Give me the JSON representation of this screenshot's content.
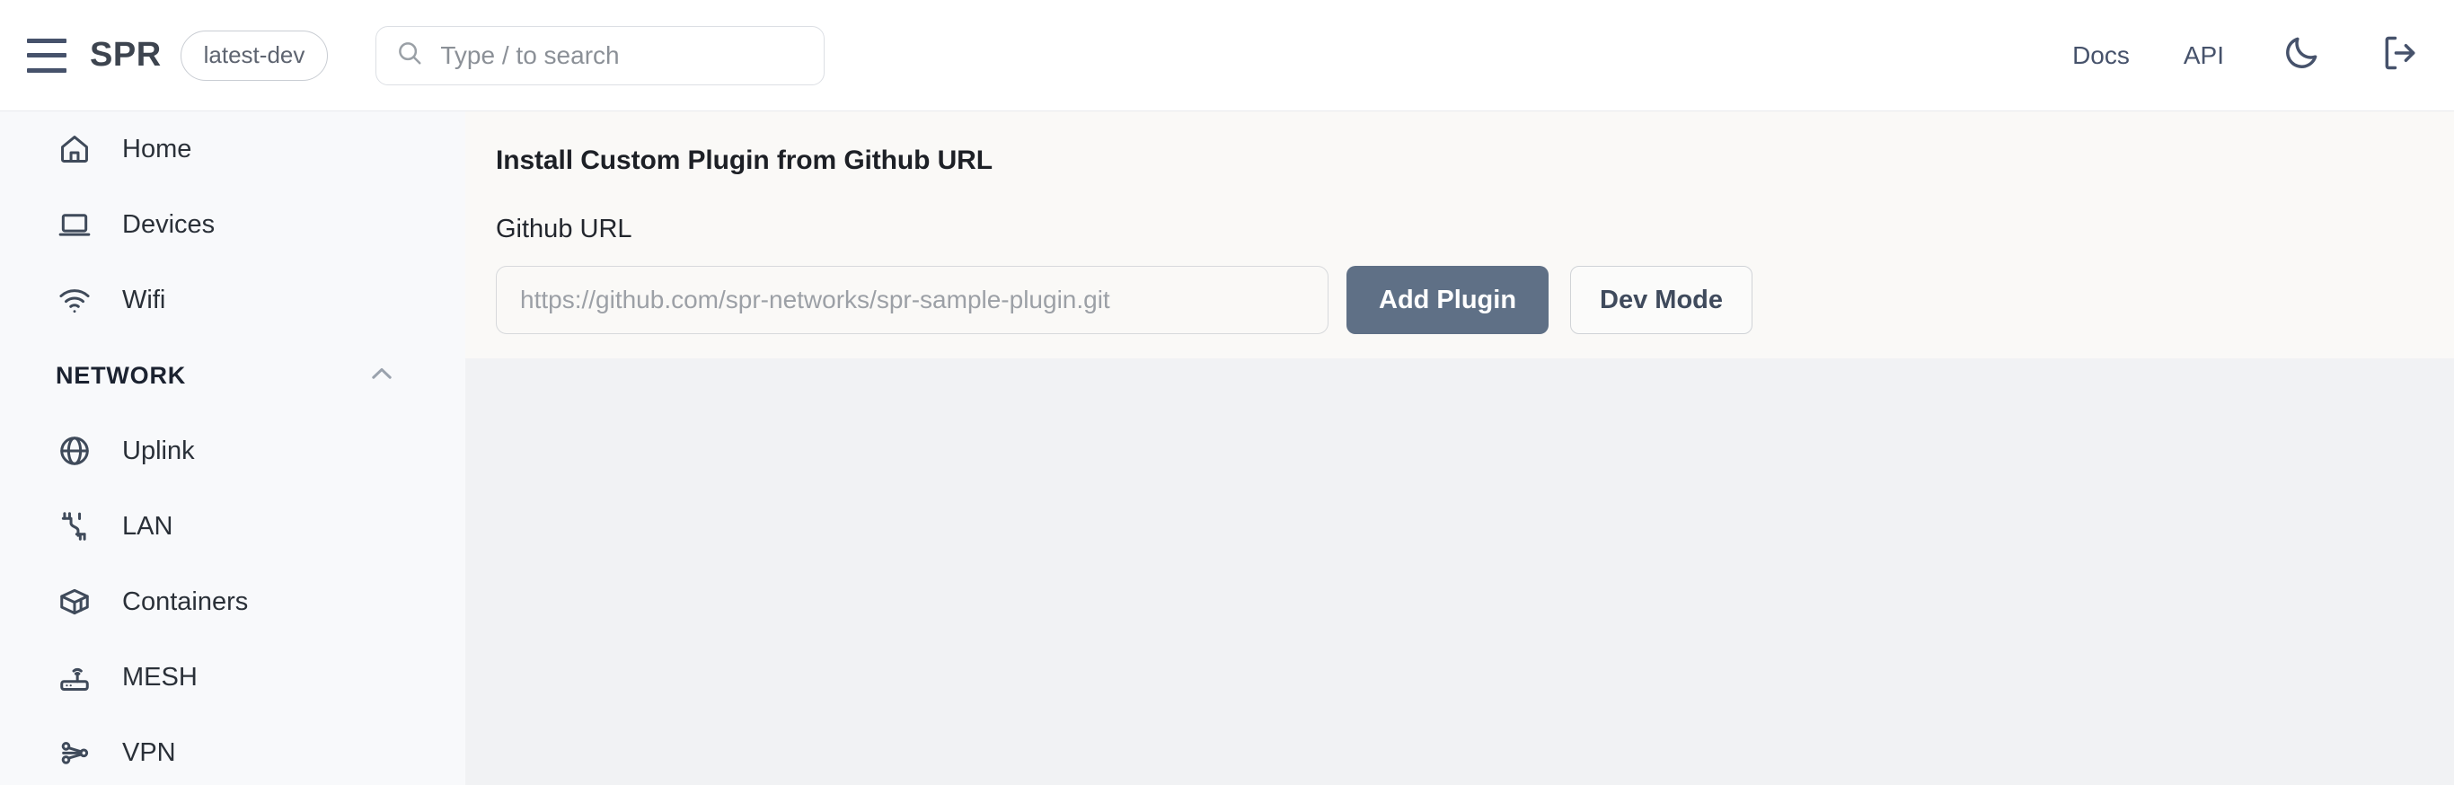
{
  "header": {
    "menu_icon": "hamburger-menu-icon",
    "brand": "SPR",
    "version_badge": "latest-dev",
    "search": {
      "icon": "search-icon",
      "placeholder": "Type / to search"
    },
    "links": [
      {
        "label": "Docs",
        "name": "docs-link"
      },
      {
        "label": "API",
        "name": "api-link"
      }
    ],
    "dark_mode_icon": "moon-icon",
    "logout_icon": "logout-icon"
  },
  "sidebar": {
    "items": [
      {
        "label": "Home",
        "icon": "home-icon",
        "type": "item"
      },
      {
        "label": "Devices",
        "icon": "laptop-icon",
        "type": "item"
      },
      {
        "label": "Wifi",
        "icon": "wifi-icon",
        "type": "item"
      },
      {
        "label": "NETWORK",
        "icon": "chevron-up-icon",
        "type": "section"
      },
      {
        "label": "Uplink",
        "icon": "globe-icon",
        "type": "item"
      },
      {
        "label": "LAN",
        "icon": "cable-icon",
        "type": "item"
      },
      {
        "label": "Containers",
        "icon": "container-box-icon",
        "type": "item"
      },
      {
        "label": "MESH",
        "icon": "router-icon",
        "type": "item"
      },
      {
        "label": "VPN",
        "icon": "network-nodes-icon",
        "type": "item"
      }
    ]
  },
  "main": {
    "panel_title": "Install Custom Plugin from Github URL",
    "field_label": "Github URL",
    "url_input_value": "",
    "url_input_placeholder": "https://github.com/spr-networks/spr-sample-plugin.git",
    "add_plugin_label": "Add Plugin",
    "dev_mode_label": "Dev Mode"
  },
  "colors": {
    "primary_button": "#5f7086",
    "panel_background": "#faf9f7",
    "content_background": "#f1f2f4",
    "sidebar_background": "#f8f9fb",
    "header_background": "#ffffff",
    "icon": "#3f4a5a"
  }
}
